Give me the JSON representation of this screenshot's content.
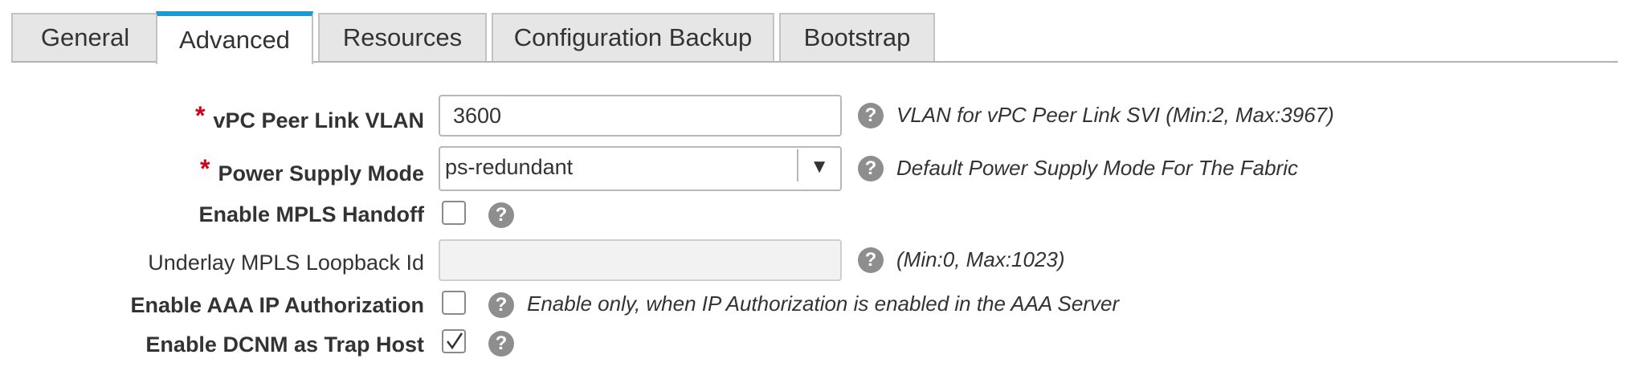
{
  "tabs": [
    {
      "label": "General",
      "active": false
    },
    {
      "label": "Advanced",
      "active": true
    },
    {
      "label": "Resources",
      "active": false
    },
    {
      "label": "Configuration Backup",
      "active": false
    },
    {
      "label": "Bootstrap",
      "active": false
    }
  ],
  "form": {
    "vpc_peer_link_vlan": {
      "required_mark": "*",
      "label": "vPC Peer Link VLAN",
      "value": "3600",
      "hint": "VLAN for vPC Peer Link SVI (Min:2, Max:3967)"
    },
    "power_supply_mode": {
      "required_mark": "*",
      "label": "Power Supply Mode",
      "value": "ps-redundant",
      "arrow": "▼",
      "hint": "Default Power Supply Mode For The Fabric"
    },
    "enable_mpls_handoff": {
      "label": "Enable MPLS Handoff",
      "checked": false
    },
    "underlay_mpls_loopback_id": {
      "label": "Underlay MPLS Loopback Id",
      "value": "",
      "disabled": true,
      "hint": "(Min:0, Max:1023)"
    },
    "enable_aaa_ip_authorization": {
      "label": "Enable AAA IP Authorization",
      "checked": false,
      "hint": "Enable only, when IP Authorization is enabled in the AAA Server"
    },
    "enable_dcnm_trap_host": {
      "label": "Enable DCNM as Trap Host",
      "checked": true
    }
  },
  "help_glyph": "?",
  "colors": {
    "accent": "#1c9ad6",
    "required": "#d0021b",
    "help_icon": "#8e8e8e",
    "tab_bg": "#e6e6e6"
  }
}
